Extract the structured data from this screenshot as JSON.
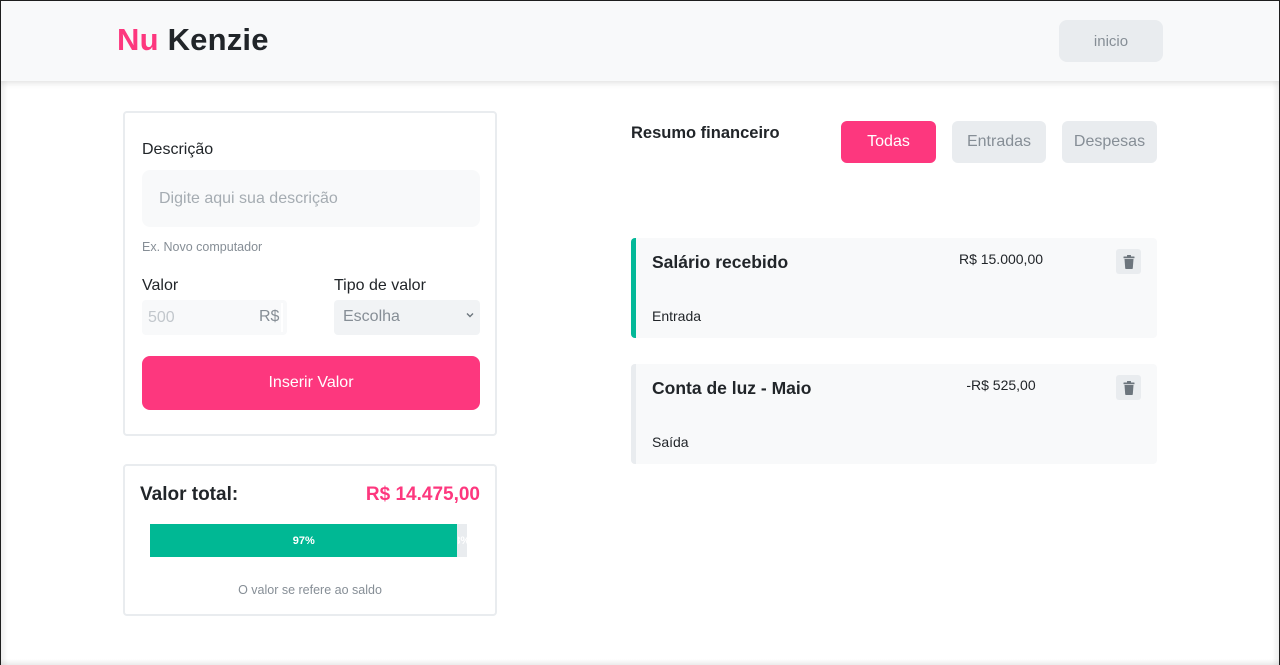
{
  "header": {
    "logo_nu": "Nu",
    "logo_kenzie": "Kenzie",
    "home_button": "inicio"
  },
  "form": {
    "description_label": "Descrição",
    "description_placeholder": "Digite aqui sua descrição",
    "description_hint": "Ex. Novo computador",
    "value_label": "Valor",
    "value_placeholder": "500",
    "currency": "R$",
    "type_label": "Tipo de valor",
    "type_selected": "Escolha",
    "submit_label": "Inserir Valor"
  },
  "total": {
    "label": "Valor total:",
    "value": "R$ 14.475,00",
    "progress_percent": 97,
    "progress_label": "97%",
    "remaining_label": "3%",
    "note": "O valor se refere ao saldo"
  },
  "summary": {
    "title": "Resumo financeiro",
    "filters": [
      "Todas",
      "Entradas",
      "Despesas"
    ],
    "entries": [
      {
        "description": "Salário recebido",
        "amount": "R$ 15.000,00",
        "type": "Entrada",
        "accent_color": "#03b898"
      },
      {
        "description": "Conta de luz - Maio",
        "amount": "-R$ 525,00",
        "type": "Saída",
        "accent_color": "#e9ecef"
      }
    ]
  },
  "colors": {
    "brand": "#fd377e",
    "entry_accent": "#03b898",
    "progress": "#00b894"
  },
  "icons": {
    "trash": "trash-icon",
    "select": "chevron-down-icon"
  }
}
